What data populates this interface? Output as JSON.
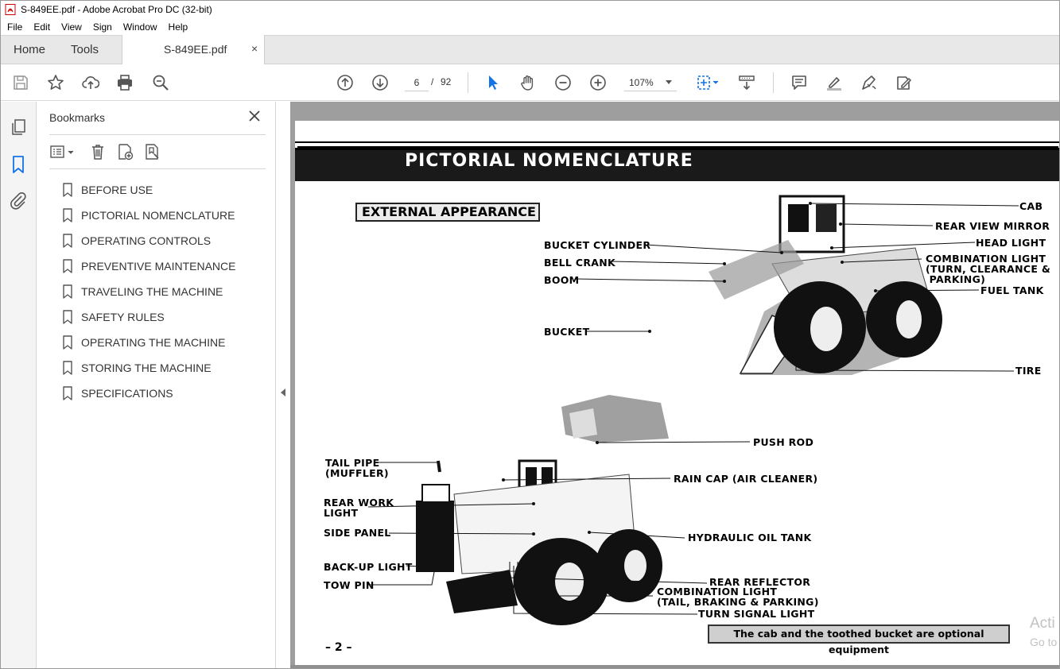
{
  "window": {
    "title": "S-849EE.pdf - Adobe Acrobat Pro DC (32-bit)"
  },
  "menu": [
    "File",
    "Edit",
    "View",
    "Sign",
    "Window",
    "Help"
  ],
  "tabs": {
    "home": "Home",
    "tools": "Tools",
    "document": "S-849EE.pdf",
    "close": "×"
  },
  "toolbar": {
    "current_page": "6",
    "page_separator": "/",
    "total_pages": "92",
    "zoom": "107%"
  },
  "bookmarks": {
    "title": "Bookmarks",
    "items": [
      "BEFORE USE",
      "PICTORIAL NOMENCLATURE",
      "OPERATING CONTROLS",
      "PREVENTIVE MAINTENANCE",
      "TRAVELING THE MACHINE",
      "SAFETY RULES",
      "OPERATING THE MACHINE",
      "STORING THE MACHINE",
      "SPECIFICATIONS"
    ]
  },
  "pdf_page": {
    "title": "PICTORIAL NOMENCLATURE",
    "section": "EXTERNAL APPEARANCE",
    "labels": {
      "cab": "CAB",
      "rear_view_mirror": "REAR VIEW MIRROR",
      "head_light": "HEAD LIGHT",
      "combination_light_front": "COMBINATION LIGHT\n(TURN, CLEARANCE &\n PARKING)",
      "fuel_tank": "FUEL TANK",
      "bucket_cylinder": "BUCKET CYLINDER",
      "bell_crank": "BELL CRANK",
      "boom": "BOOM",
      "bucket": "BUCKET",
      "tire": "TIRE",
      "push_rod": "PUSH ROD",
      "tail_pipe": "TAIL PIPE\n(MUFFLER)",
      "rain_cap": "RAIN CAP (AIR CLEANER)",
      "rear_work_light": "REAR WORK\nLIGHT",
      "side_panel": "SIDE PANEL",
      "hydraulic_oil_tank": "HYDRAULIC OIL TANK",
      "back_up_light": "BACK-UP LIGHT",
      "tow_pin": "TOW PIN",
      "rear_reflector": "REAR REFLECTOR",
      "combination_light_rear": "COMBINATION LIGHT\n(TAIL, BRAKING & PARKING)",
      "turn_signal_light": "TURN SIGNAL LIGHT"
    },
    "page_number": "– 2 –",
    "note": "The cab and the toothed bucket are optional equipment",
    "watermark_line1": "Acti",
    "watermark_line2": "Go to"
  }
}
